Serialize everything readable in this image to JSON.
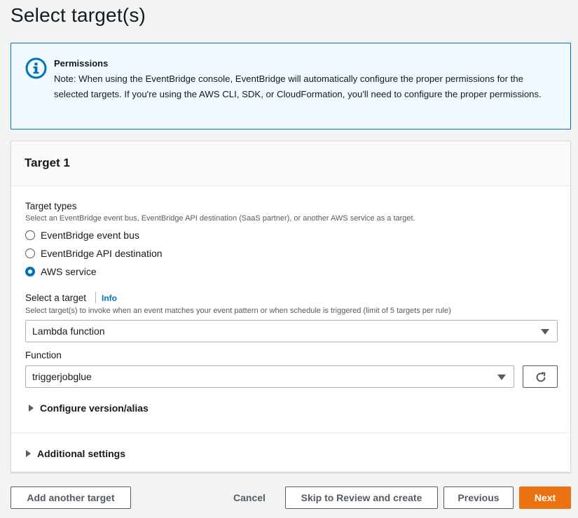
{
  "page": {
    "title": "Select target(s)"
  },
  "alert": {
    "title": "Permissions",
    "body": "Note: When using the EventBridge console, EventBridge will automatically configure the proper permissions for the selected targets. If you're using the AWS CLI, SDK, or CloudFormation, you'll need to configure the proper permissions.",
    "icon": "info-icon",
    "color": "#0073bb"
  },
  "target": {
    "title": "Target 1",
    "types": {
      "label": "Target types",
      "description": "Select an EventBridge event bus, EventBridge API destination (SaaS partner), or another AWS service as a target.",
      "options": [
        "EventBridge event bus",
        "EventBridge API destination",
        "AWS service"
      ],
      "selected": "AWS service"
    },
    "select_target": {
      "label": "Select a target",
      "info": "Info",
      "description": "Select target(s) to invoke when an event matches your event pattern or when schedule is triggered (limit of 5 targets per rule)",
      "value": "Lambda function"
    },
    "function": {
      "label": "Function",
      "value": "triggerjobglue",
      "refresh_icon": "refresh-icon"
    },
    "version_alias": "Configure version/alias",
    "additional_settings": "Additional settings"
  },
  "footer": {
    "add_target": "Add another target",
    "cancel": "Cancel",
    "skip": "Skip to Review and create",
    "previous": "Previous",
    "next": "Next"
  },
  "colors": {
    "accent": "#0073bb",
    "primary_button": "#ec7211"
  }
}
